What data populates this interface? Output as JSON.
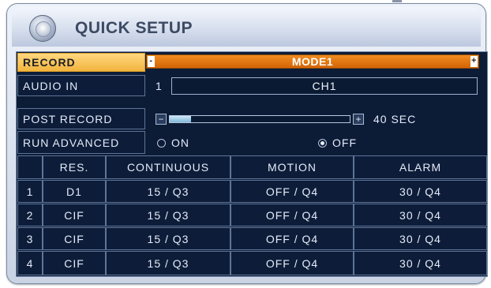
{
  "window": {
    "title": "QUICK SETUP"
  },
  "settings": {
    "record": {
      "label": "RECORD",
      "value": "MODE1",
      "prev": "-",
      "next": "+"
    },
    "audio_in": {
      "label": "AUDIO IN",
      "index": "1",
      "value": "CH1"
    },
    "post_record": {
      "label": "POST RECORD",
      "value": "40 SEC",
      "level": 0.12,
      "minus": "−",
      "plus": "+"
    },
    "run_advanced": {
      "label": "RUN ADVANCED",
      "options": [
        "ON",
        "OFF"
      ],
      "selected": "OFF"
    }
  },
  "table": {
    "columns": [
      "",
      "RES.",
      "CONTINUOUS",
      "MOTION",
      "ALARM"
    ],
    "rows": [
      [
        "1",
        "D1",
        "15 / Q3",
        "OFF / Q4",
        "30 / Q4"
      ],
      [
        "2",
        "CIF",
        "15 / Q3",
        "OFF / Q4",
        "30 / Q4"
      ],
      [
        "3",
        "CIF",
        "15 / Q3",
        "OFF / Q4",
        "30 / Q4"
      ],
      [
        "4",
        "CIF",
        "15 / Q3",
        "OFF / Q4",
        "30 / Q4"
      ]
    ]
  },
  "colors": {
    "accent": "#e67814",
    "selected_label": "#f6c35a",
    "panel_bg": "#0c1c37"
  },
  "icons": {
    "title": "setup-disc-icon"
  }
}
